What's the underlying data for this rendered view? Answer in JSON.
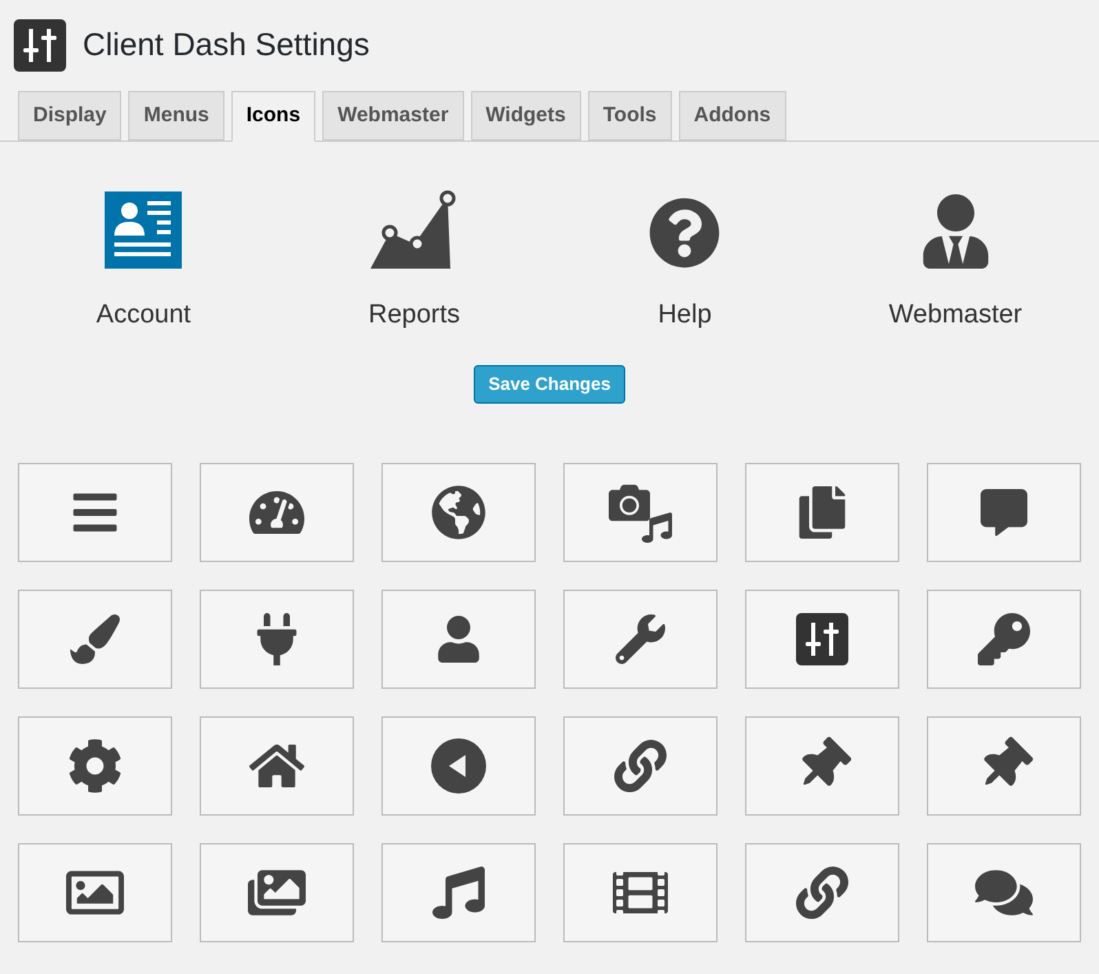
{
  "page": {
    "title": "Client Dash Settings"
  },
  "tabs": [
    {
      "label": "Display",
      "selected": false
    },
    {
      "label": "Menus",
      "selected": false
    },
    {
      "label": "Icons",
      "selected": true
    },
    {
      "label": "Webmaster",
      "selected": false
    },
    {
      "label": "Widgets",
      "selected": false
    },
    {
      "label": "Tools",
      "selected": false
    },
    {
      "label": "Addons",
      "selected": false
    }
  ],
  "preview": [
    {
      "kind": "account",
      "label": "Account",
      "selected": true
    },
    {
      "kind": "reports",
      "label": "Reports",
      "selected": false
    },
    {
      "kind": "help",
      "label": "Help",
      "selected": false
    },
    {
      "kind": "webmaster",
      "label": "Webmaster",
      "selected": false
    }
  ],
  "save_button": "Save Changes"
}
